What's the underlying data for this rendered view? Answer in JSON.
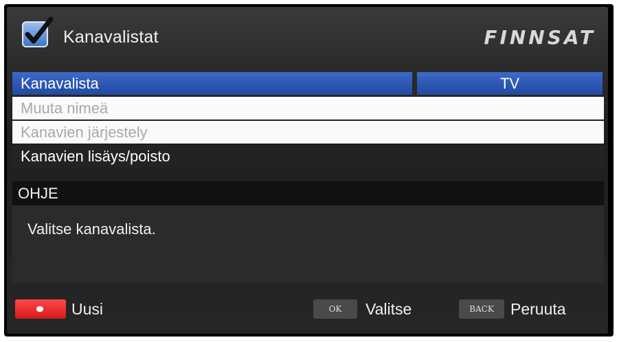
{
  "header": {
    "title": "Kanavalistat",
    "logo": "FINNSAT",
    "icon": "checkbox-checked-icon"
  },
  "menu": {
    "items": [
      {
        "label": "Kanavalista",
        "value": "TV",
        "state": "selected"
      },
      {
        "label": "Muuta nimeä",
        "state": "disabled"
      },
      {
        "label": "Kanavien järjestely",
        "state": "disabled"
      },
      {
        "label": "Kanavien lisäys/poisto",
        "state": "normal"
      }
    ]
  },
  "help": {
    "heading": "OHJE",
    "text": "Valitse kanavalista."
  },
  "footer": {
    "red_label": "Uusi",
    "ok_key": "OK",
    "ok_label": "Valitse",
    "back_key": "BACK",
    "back_label": "Peruuta"
  },
  "colors": {
    "selected": "#2b55b0",
    "red_key": "#d61a1a",
    "disabled_bg": "#fafafa"
  }
}
